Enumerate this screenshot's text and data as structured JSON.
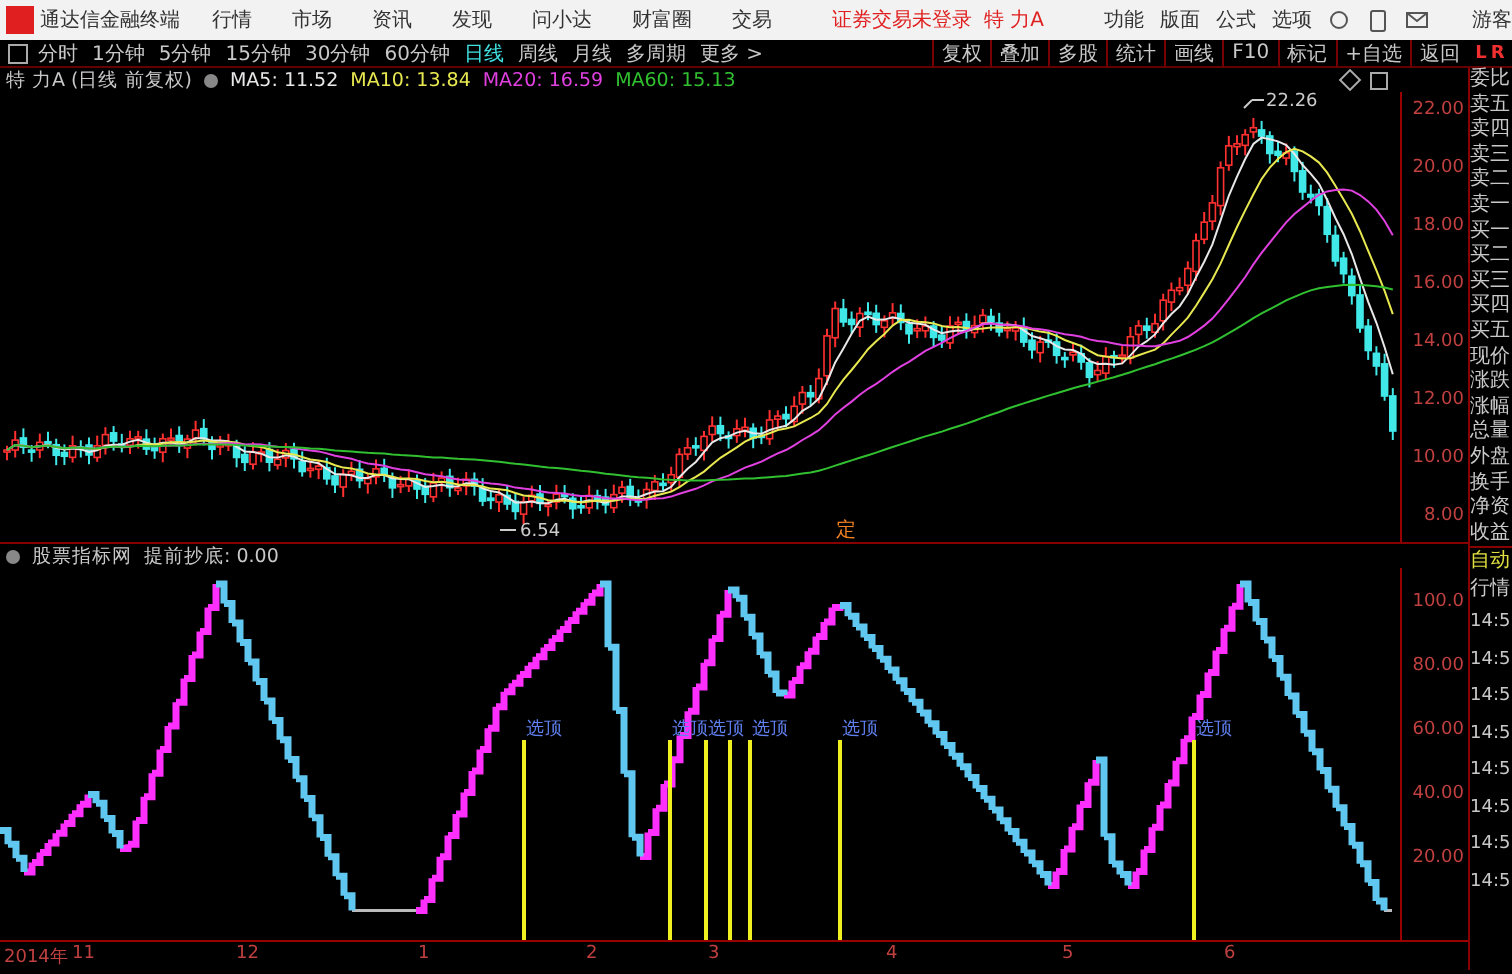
{
  "app_bar": {
    "app_title": "通达信金融终端",
    "menu": [
      "行情",
      "市场",
      "资讯",
      "发现",
      "问小达",
      "财富圈",
      "交易"
    ],
    "status_notice": "证券交易未登录",
    "stock_name": "特 力A",
    "tools": [
      "功能",
      "版面",
      "公式",
      "选项"
    ],
    "user": "游客"
  },
  "toolbar": {
    "periods": [
      {
        "label": "分时",
        "selected": false
      },
      {
        "label": "1分钟",
        "selected": false
      },
      {
        "label": "5分钟",
        "selected": false
      },
      {
        "label": "15分钟",
        "selected": false
      },
      {
        "label": "30分钟",
        "selected": false
      },
      {
        "label": "60分钟",
        "selected": false
      },
      {
        "label": "日线",
        "selected": true
      },
      {
        "label": "周线",
        "selected": false
      },
      {
        "label": "月线",
        "selected": false
      },
      {
        "label": "多周期",
        "selected": false
      },
      {
        "label": "更多 >",
        "selected": false
      }
    ],
    "actions": [
      "复权",
      "叠加",
      "多股",
      "统计",
      "画线",
      "F10",
      "标记",
      "+自选",
      "返回"
    ]
  },
  "price_chart": {
    "title": "特 力A (日线 前复权)",
    "indicators": [
      {
        "name": "MA5: 11.52",
        "color": "#e8e8e8"
      },
      {
        "name": "MA10: 13.84",
        "color": "#e8e850"
      },
      {
        "name": "MA20: 16.59",
        "color": "#e040e0"
      },
      {
        "name": "MA60: 15.13",
        "color": "#30c030"
      }
    ],
    "y_labels": [
      "22.00",
      "20.00",
      "18.00",
      "16.00",
      "14.00",
      "12.00",
      "10.00",
      "8.00"
    ],
    "high_label": "22.26",
    "low_label": "6.54",
    "marker": "定"
  },
  "indicator_chart": {
    "title": "股票指标网",
    "formula": "提前抄底: 0.00",
    "y_labels": [
      "100.0",
      "80.00",
      "60.00",
      "40.00",
      "20.00"
    ],
    "signals": [
      {
        "kind": "labeled",
        "label": "选顶"
      },
      {
        "kind": "labeled",
        "label": "选顶"
      },
      {
        "kind": "labeled",
        "label": "选顶"
      },
      {
        "kind": "plain"
      },
      {
        "kind": "labeled",
        "label": "选顶"
      },
      {
        "kind": "labeled",
        "label": "选顶"
      },
      {
        "kind": "labeled",
        "label": "选顶"
      }
    ]
  },
  "x_axis": [
    "2014年",
    "11",
    "12",
    "1",
    "2",
    "3",
    "4",
    "5",
    "6"
  ],
  "quote_panel": {
    "logo": [
      "L",
      "R"
    ],
    "fields": [
      "委比",
      "卖五",
      "卖四",
      "卖三",
      "卖二",
      "卖一",
      "买一",
      "买二",
      "买三",
      "买四",
      "买五",
      "现价",
      "涨跌",
      "涨幅",
      "总量",
      "外盘",
      "换手",
      "净资",
      "收益"
    ],
    "auto": "自动",
    "quotes_label": "行情",
    "times": [
      "14:5",
      "14:5",
      "14:5",
      "14:5",
      "14:5",
      "14:5",
      "14:5",
      "14:5"
    ]
  }
}
